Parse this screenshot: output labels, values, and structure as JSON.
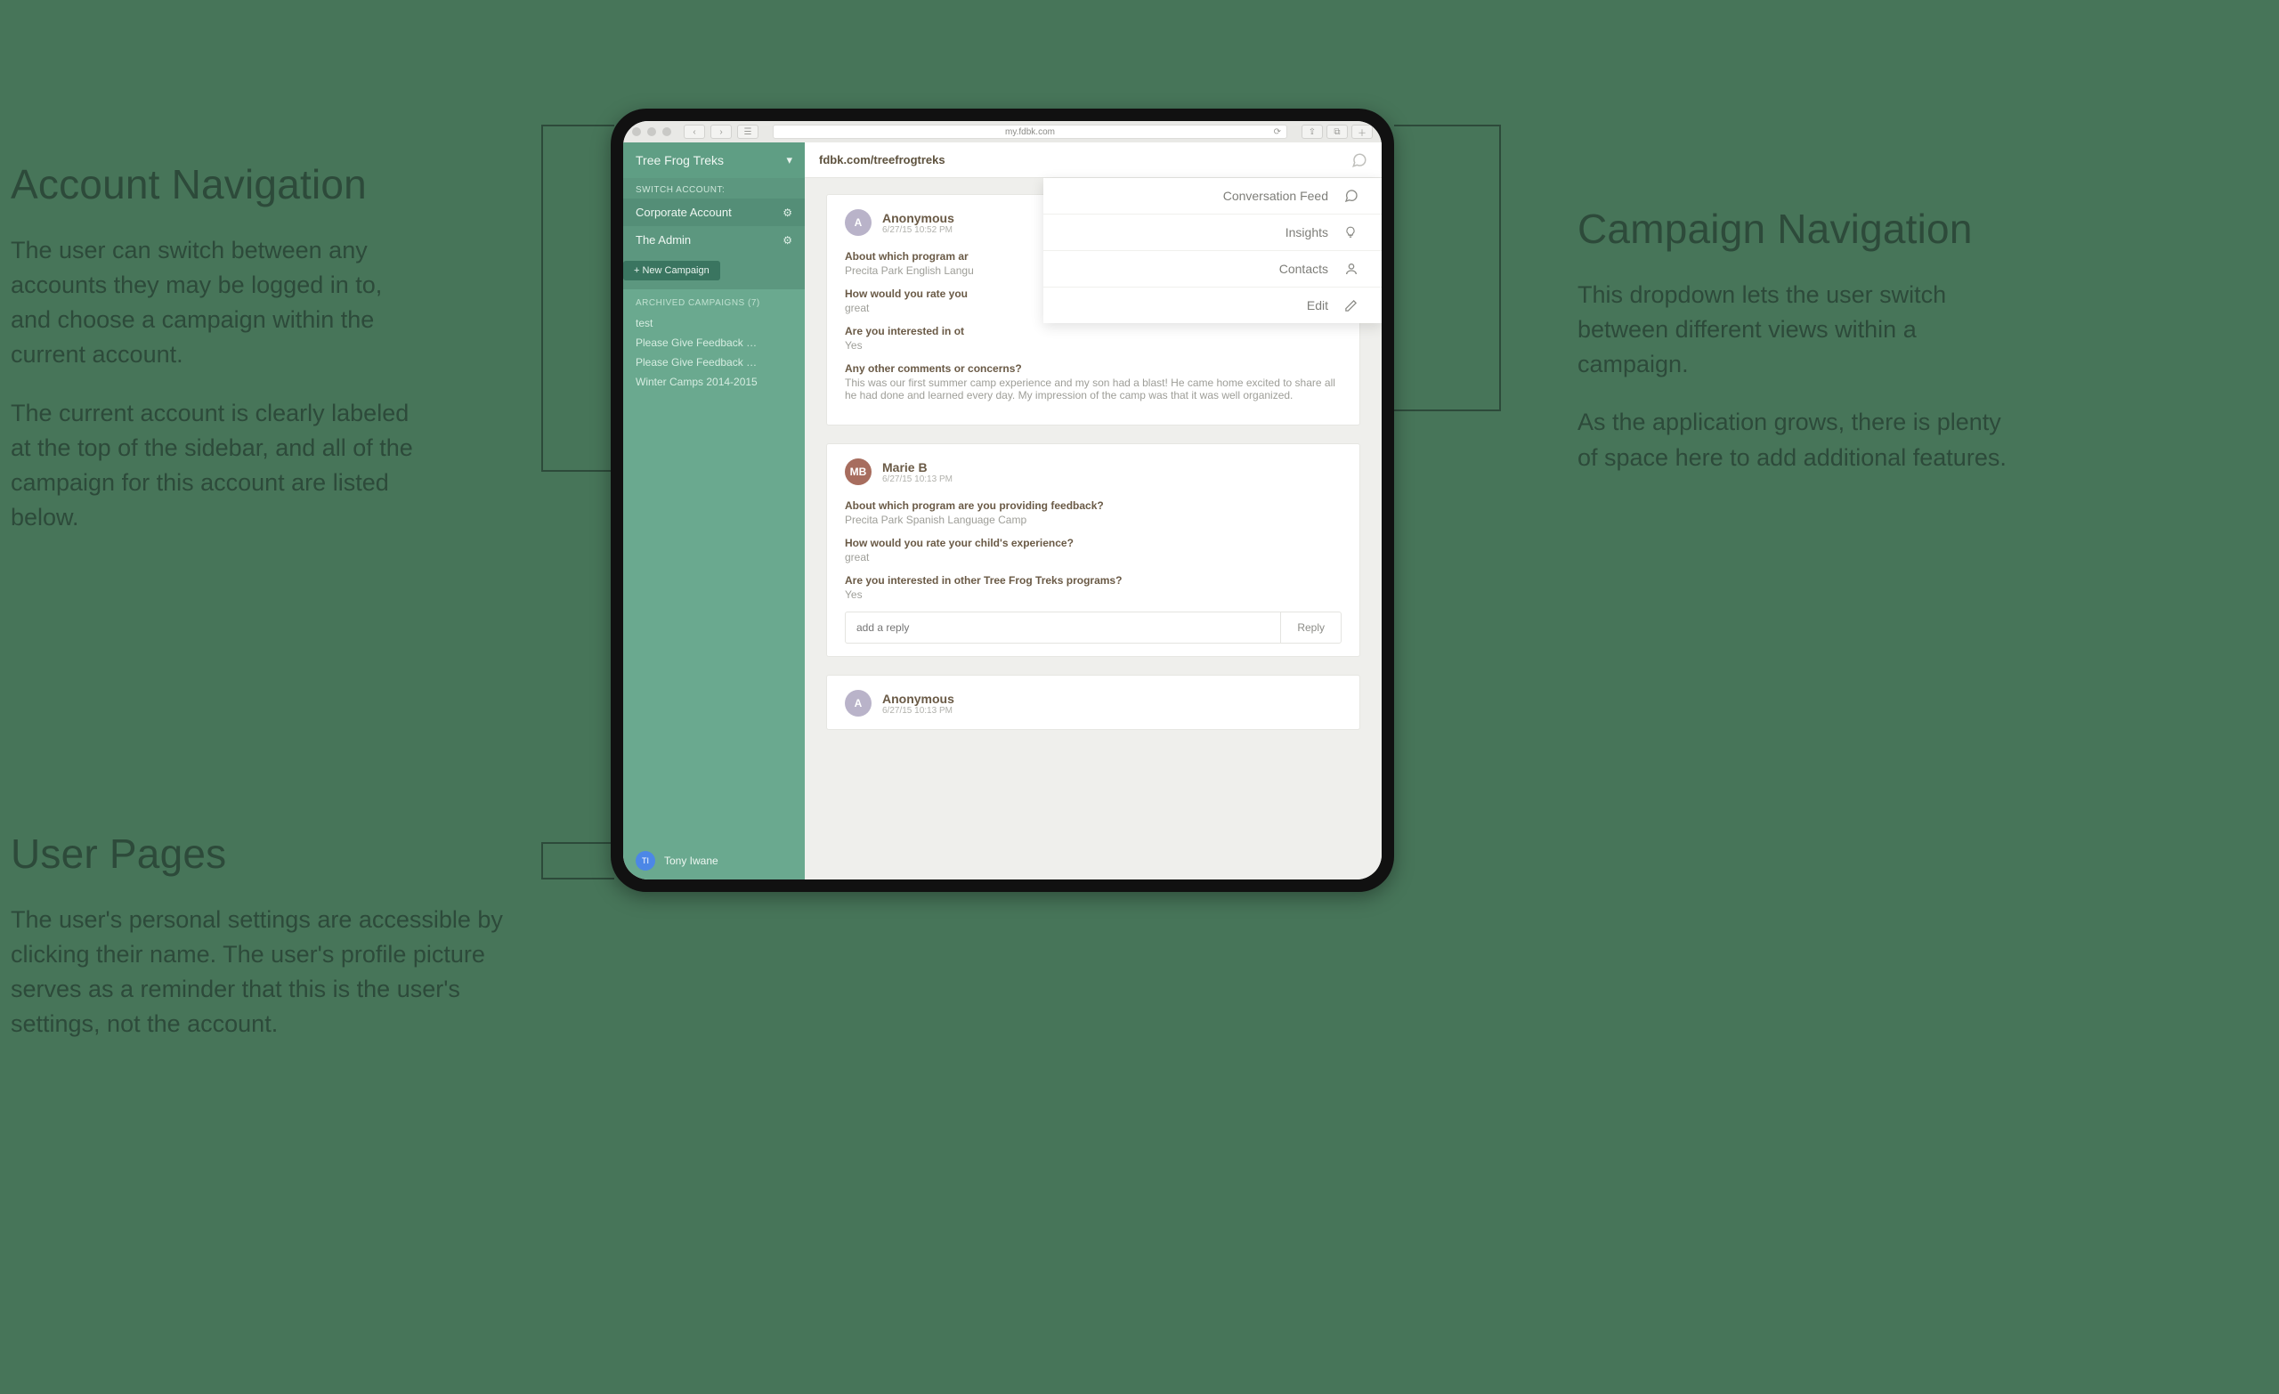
{
  "annotations": {
    "account_nav": {
      "title": "Account Navigation",
      "p1": "The user can switch between any accounts they may be logged in to, and choose a campaign within the current account.",
      "p2": "The current account is clearly labeled at the top of the sidebar, and all of the campaign for this account are listed below."
    },
    "user_pages": {
      "title": "User Pages",
      "p1": "The user's personal settings are accessible by clicking their name. The user's profile picture serves as a reminder that this is the user's settings, not the account."
    },
    "campaign_nav": {
      "title": "Campaign Navigation",
      "p1": "This dropdown lets the user switch between different views within a campaign.",
      "p2": "As the application grows, there is plenty of space here to add additional features."
    }
  },
  "browser": {
    "url": "my.fdbk.com"
  },
  "sidebar": {
    "account_name": "Tree Frog Treks",
    "switch_label": "SWITCH ACCOUNT:",
    "accounts": [
      "Corporate Account",
      "The Admin"
    ],
    "new_campaign": "+ New Campaign",
    "archived_label": "ARCHIVED CAMPAIGNS (7)",
    "archived": [
      "test",
      "Please Give Feedback …",
      "Please Give Feedback …",
      "Winter Camps 2014-2015"
    ],
    "user_initials": "TI",
    "user_name": "Tony Iwane"
  },
  "topbar": {
    "campaign_url": "fdbk.com/treefrogtreks"
  },
  "dropdown": {
    "items": [
      "Conversation Feed",
      "Insights",
      "Contacts",
      "Edit"
    ]
  },
  "feed": {
    "reply_placeholder": "add a reply",
    "reply_button": "Reply",
    "questions": {
      "program_full": "About which program are you providing feedback?",
      "program_trunc": "About which program ar",
      "rate_full": "How would you rate your child's experience?",
      "rate_trunc": "How would you rate you",
      "interested_full": "Are you interested in other Tree Frog Treks programs?",
      "interested_trunc": "Are you interested in ot",
      "comments": "Any other comments or concerns?"
    },
    "cards": [
      {
        "initial": "A",
        "name": "Anonymous",
        "time": "6/27/15 10:52 PM",
        "program": "Precita Park English Langu",
        "rate": "great",
        "interested": "Yes",
        "comments": "This was our first summer camp experience and my son had a blast! He came home excited to share all he had done and learned every day. My impression of the camp was that it was well organized."
      },
      {
        "initial": "MB",
        "name": "Marie B",
        "time": "6/27/15 10:13 PM",
        "program": "Precita Park Spanish Language Camp",
        "rate": "great",
        "interested": "Yes"
      },
      {
        "initial": "A",
        "name": "Anonymous",
        "time": "6/27/15 10:13 PM"
      }
    ]
  }
}
